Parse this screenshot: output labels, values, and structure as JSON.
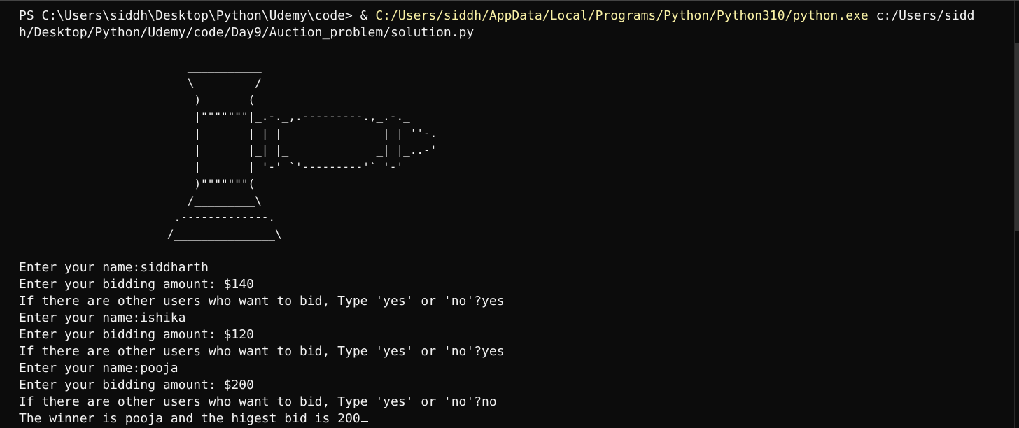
{
  "terminal": {
    "command": {
      "prompt": "PS C:\\Users\\siddh\\Desktop\\Python\\Udemy\\code> & ",
      "exe_path": "C:/Users/siddh/AppData/Local/Programs/Python/Python310/python.exe",
      "script_arg_line1": " c:/Users/sidd",
      "script_arg_line2": "h/Desktop/Python/Udemy/code/Day9/Auction_problem/solution.py"
    },
    "ascii_art": "                         ___________\n                         \\         /\n                          )_______(\n                          |\"\"\"\"\"\"\"|_.-._,.---------.,_.-._\n                          |       | | |               | | ''-.\n                          |       |_| |_             _| |_..-'\n                          |_______| '-' `'---------'` '-'\n                          )\"\"\"\"\"\"\"(\n                         /_________\\\n                       .-------------.\n                      /_______________\\",
    "output_lines": [
      "Enter your name:siddharth",
      "Enter your bidding amount: $140",
      "If there are other users who want to bid, Type 'yes' or 'no'?yes",
      "Enter your name:ishika",
      "Enter your bidding amount: $120",
      "If there are other users who want to bid, Type 'yes' or 'no'?yes",
      "Enter your name:pooja",
      "Enter your bidding amount: $200",
      "If there are other users who want to bid, Type 'yes' or 'no'?no",
      "The winner is pooja and the higest bid is 200"
    ]
  },
  "colors": {
    "background": "#0c0c0c",
    "text": "#f2f2f2",
    "path_highlight": "#f9f1a5"
  }
}
